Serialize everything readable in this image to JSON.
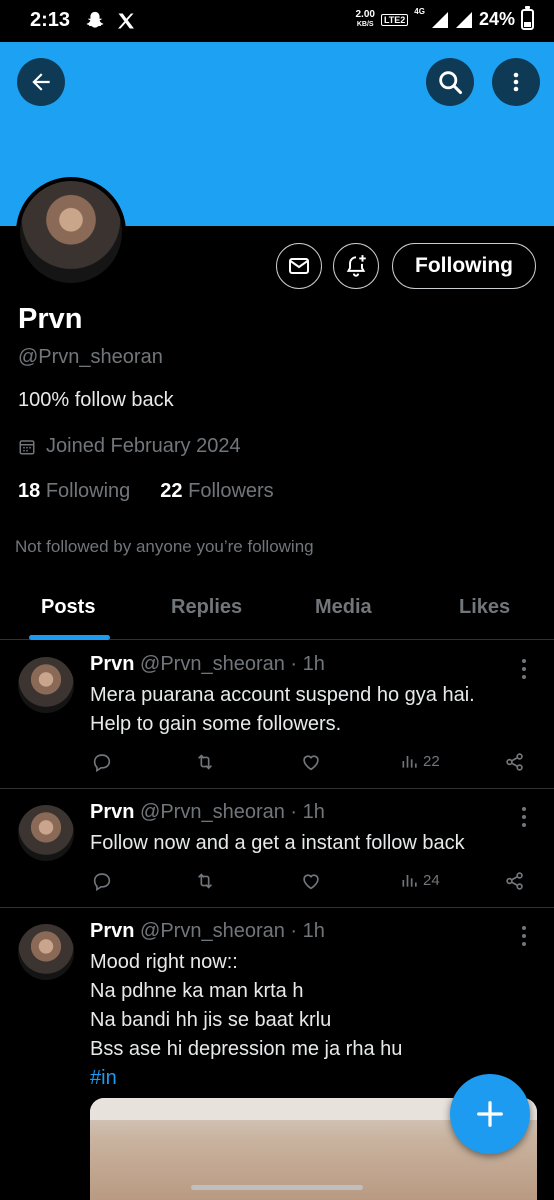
{
  "status_bar": {
    "time": "2:13",
    "speed_value": "2.00",
    "speed_unit": "KB/S",
    "volte": "LTE2",
    "network": "4G",
    "battery": "24%"
  },
  "profile": {
    "name": "Prvn",
    "handle": "@Prvn_sheoran",
    "bio": "100% follow back",
    "joined": "Joined February 2024",
    "following_count": "18",
    "following_label": "Following",
    "followers_count": "22",
    "followers_label": "Followers",
    "not_followed": "Not followed by anyone you’re following",
    "follow_button": "Following"
  },
  "tabs": [
    "Posts",
    "Replies",
    "Media",
    "Likes"
  ],
  "active_tab": "Posts",
  "posts": [
    {
      "name": "Prvn",
      "handle": "@Prvn_sheoran",
      "time": "· 1h",
      "lines": [
        "Mera puarana account suspend ho gya hai.  ",
        "Help to gain some followers."
      ],
      "views": "22"
    },
    {
      "name": "Prvn",
      "handle": "@Prvn_sheoran",
      "time": "· 1h",
      "lines": [
        "Follow now and a get a instant follow back"
      ],
      "views": "24"
    },
    {
      "name": "Prvn",
      "handle": "@Prvn_sheoran",
      "time": "· 1h",
      "lines": [
        "Mood right now::",
        "Na pdhne ka man krta h",
        "Na bandi hh jis se baat krlu",
        "Bss ase hi depression me ja rha hu"
      ],
      "hashtag": "#in"
    }
  ],
  "colors": {
    "banner": "#1da1f2",
    "accent": "#1d9bf0",
    "background": "#000000",
    "secondary_text": "#71767b"
  }
}
